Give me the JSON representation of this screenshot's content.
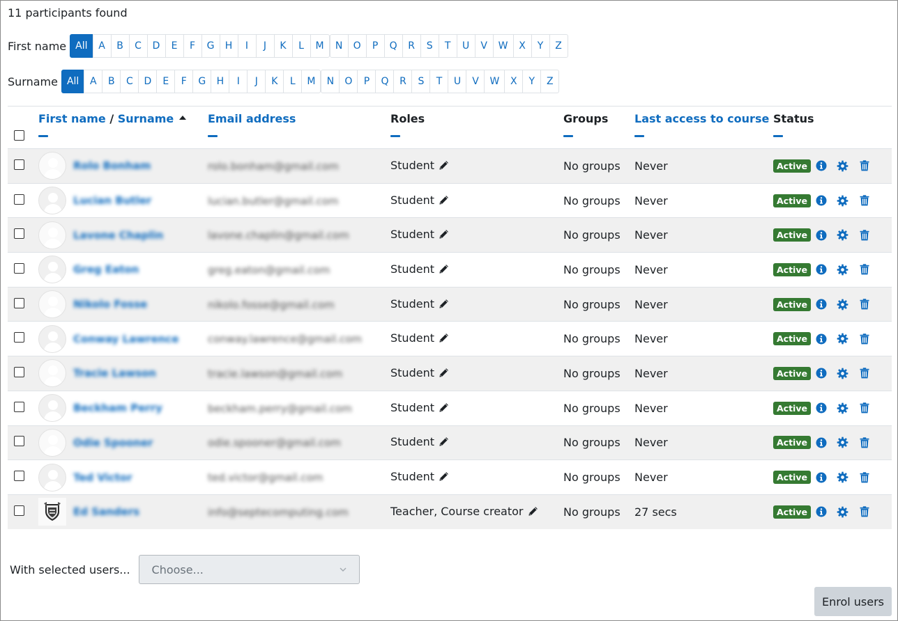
{
  "participants_count": "11 participants found",
  "firstname_filter": {
    "label": "First name",
    "all_label": "All",
    "letters_a_m": [
      "A",
      "B",
      "C",
      "D",
      "E",
      "F",
      "G",
      "H",
      "I",
      "J",
      "K",
      "L",
      "M"
    ],
    "letters_n_z": [
      "N",
      "O",
      "P",
      "Q",
      "R",
      "S",
      "T",
      "U",
      "V",
      "W",
      "X",
      "Y",
      "Z"
    ]
  },
  "surname_filter": {
    "label": "Surname",
    "all_label": "All",
    "letters_a_m": [
      "A",
      "B",
      "C",
      "D",
      "E",
      "F",
      "G",
      "H",
      "I",
      "J",
      "K",
      "L",
      "M"
    ],
    "letters_n_z": [
      "N",
      "O",
      "P",
      "Q",
      "R",
      "S",
      "T",
      "U",
      "V",
      "W",
      "X",
      "Y",
      "Z"
    ]
  },
  "table": {
    "headers": {
      "first_name": "First name",
      "separator": " / ",
      "surname": "Surname",
      "email": "Email address",
      "roles": "Roles",
      "groups": "Groups",
      "last_access": "Last access to course",
      "status": "Status"
    },
    "rows": [
      {
        "name": "Rolo Bonham",
        "email": "rolo.bonham@gmail.com",
        "role": "Student",
        "groups": "No groups",
        "last_access": "Never",
        "status": "Active",
        "avatar": "default"
      },
      {
        "name": "Lucian Butler",
        "email": "lucian.butler@gmail.com",
        "role": "Student",
        "groups": "No groups",
        "last_access": "Never",
        "status": "Active",
        "avatar": "default"
      },
      {
        "name": "Lavone Chaplin",
        "email": "lavone.chaplin@gmail.com",
        "role": "Student",
        "groups": "No groups",
        "last_access": "Never",
        "status": "Active",
        "avatar": "default"
      },
      {
        "name": "Greg Eaton",
        "email": "greg.eaton@gmail.com",
        "role": "Student",
        "groups": "No groups",
        "last_access": "Never",
        "status": "Active",
        "avatar": "default"
      },
      {
        "name": "Nikolo Fosse",
        "email": "nikolo.fosse@gmail.com",
        "role": "Student",
        "groups": "No groups",
        "last_access": "Never",
        "status": "Active",
        "avatar": "default"
      },
      {
        "name": "Conway Lawrence",
        "email": "conway.lawrence@gmail.com",
        "role": "Student",
        "groups": "No groups",
        "last_access": "Never",
        "status": "Active",
        "avatar": "default"
      },
      {
        "name": "Tracie Lawson",
        "email": "tracie.lawson@gmail.com",
        "role": "Student",
        "groups": "No groups",
        "last_access": "Never",
        "status": "Active",
        "avatar": "default"
      },
      {
        "name": "Beckham Perry",
        "email": "beckham.perry@gmail.com",
        "role": "Student",
        "groups": "No groups",
        "last_access": "Never",
        "status": "Active",
        "avatar": "default"
      },
      {
        "name": "Odie Spooner",
        "email": "odie.spooner@gmail.com",
        "role": "Student",
        "groups": "No groups",
        "last_access": "Never",
        "status": "Active",
        "avatar": "default"
      },
      {
        "name": "Ted Victor",
        "email": "ted.victor@gmail.com",
        "role": "Student",
        "groups": "No groups",
        "last_access": "Never",
        "status": "Active",
        "avatar": "default"
      },
      {
        "name": "Ed Sanders",
        "email": "info@septecomputing.com",
        "role": "Teacher, Course creator",
        "groups": "No groups",
        "last_access": "27 secs",
        "status": "Active",
        "avatar": "crest"
      }
    ]
  },
  "bulk_actions": {
    "label": "With selected users...",
    "select_value": "Choose..."
  },
  "enrol_button_label": "Enrol users",
  "colors": {
    "primary": "#0f6cbf",
    "active_badge": "#357a32",
    "row_stripe": "#f0f0f0"
  },
  "icons": {
    "sort": "caret-up-icon",
    "role_edit": "pencil-icon",
    "status_details": "info-circle-icon",
    "edit_enrolment": "gear-icon",
    "unenrol": "trash-icon",
    "select_dropdown": "chevron-down-icon"
  }
}
